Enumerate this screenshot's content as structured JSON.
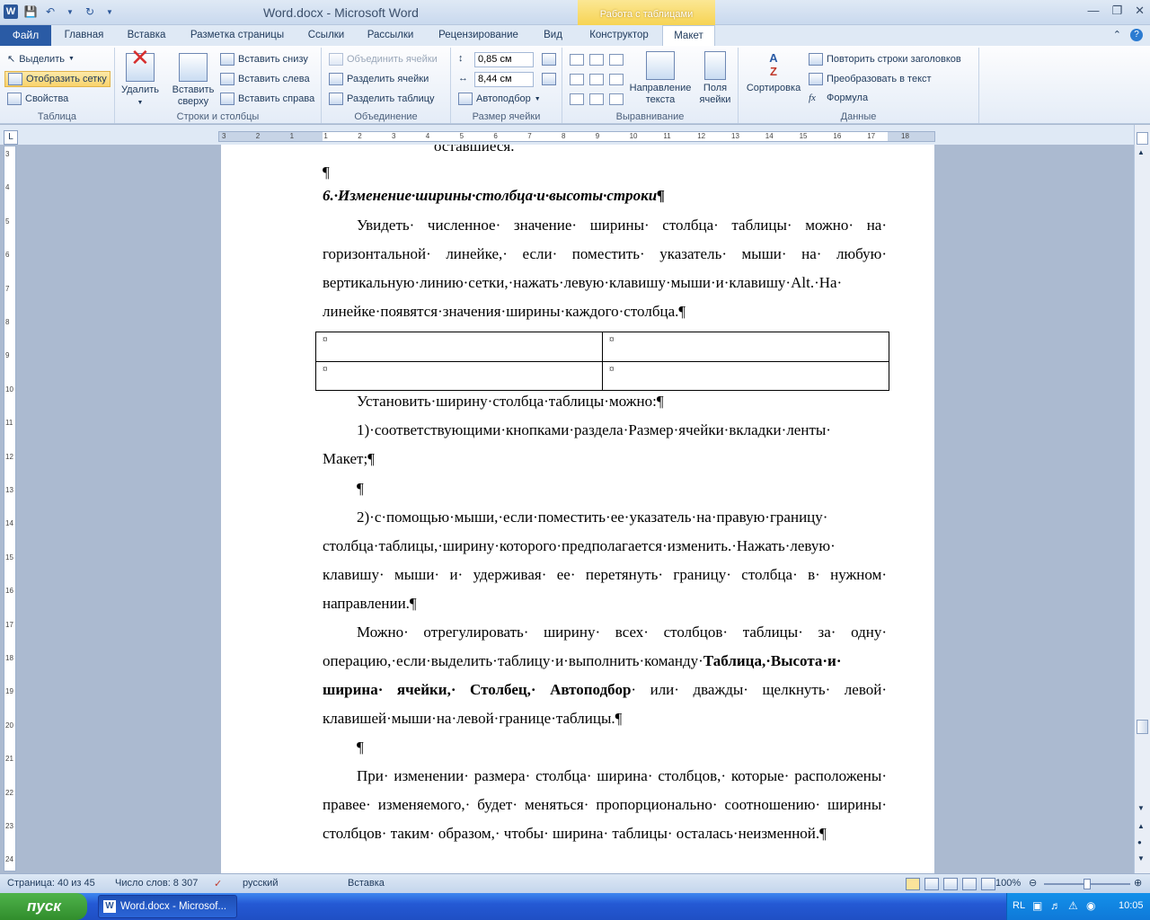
{
  "window": {
    "title": "Word.docx  -  Microsoft Word",
    "context_group": "Работа с таблицами"
  },
  "tabs": {
    "file": "Файл",
    "items": [
      "Главная",
      "Вставка",
      "Разметка страницы",
      "Ссылки",
      "Рассылки",
      "Рецензирование",
      "Вид",
      "Конструктор",
      "Макет"
    ],
    "active": "Макет"
  },
  "ribbon": {
    "table": {
      "title": "Таблица",
      "select": "Выделить",
      "show_grid": "Отобразить сетку",
      "properties": "Свойства"
    },
    "rows_cols": {
      "title": "Строки и столбцы",
      "delete": "Удалить",
      "insert_above_1": "Вставить",
      "insert_above_2": "сверху",
      "insert_below": "Вставить снизу",
      "insert_left": "Вставить слева",
      "insert_right": "Вставить справа"
    },
    "merge": {
      "title": "Объединение",
      "merge_cells": "Объединить ячейки",
      "split_cells": "Разделить ячейки",
      "split_table": "Разделить таблицу"
    },
    "cell_size": {
      "title": "Размер ячейки",
      "height": "0,85 см",
      "width": "8,44 см",
      "autofit": "Автоподбор"
    },
    "alignment": {
      "title": "Выравнивание",
      "direction_1": "Направление",
      "direction_2": "текста",
      "margins_1": "Поля",
      "margins_2": "ячейки"
    },
    "data": {
      "title": "Данные",
      "sort": "Сортировка",
      "repeat_header": "Повторить строки заголовков",
      "convert": "Преобразовать в текст",
      "formula": "Формула"
    }
  },
  "document": {
    "line0": "оставшиеся.",
    "empty_para": "¶",
    "heading": "6.·Изменение·ширины·столбца·и·высоты·строки¶",
    "para1": "Увидеть· численное· значение· ширины· столбца· таблицы· можно· на· горизонтальной· линейке,· если· поместить· указатель· мыши· на· любую· вертикальную·линию·сетки,·нажать·левую·клавишу·мыши·и·клавишу·Alt.·На· линейке·появятся·значения·ширины·каждого·столбца.¶",
    "cell_mark": "¤",
    "para2": "Установить·ширину·столбца·таблицы·можно:¶",
    "list1": "1)·соответствующими·кнопками·раздела·Размер·ячейки·вкладки·ленты· Макет;¶",
    "list2": "2)·с·помощью·мыши,·если·поместить·ее·указатель·на·правую·границу· столбца·таблицы,·ширину·которого·предполагается·изменить.·Нажать·левую· клавишу· мыши· и· удерживая· ее· перетянуть· границу· столбца· в· нужном· направлении.¶",
    "para3_a": "Можно· отрегулировать· ширину· всех· столбцов· таблицы· за· одну· операцию,·если·выделить·таблицу·и·выполнить·команду·",
    "para3_b": "Таблица,·Высота·и· ширина· ячейки,· Столбец,· Автоподбор",
    "para3_c": "· или· дважды· щелкнуть· левой· клавишей·мыши·на·левой·границе·таблицы.¶",
    "para4": "При· изменении· размера· столбца· ширина· столбцов,· которые· расположены· правее· изменяемого,· будет· меняться· пропорционально· соотношению· ширины· столбцов· таким· образом,· чтобы· ширина· таблицы· осталась·неизменной.¶"
  },
  "ruler": {
    "h_ticks": [
      "3",
      "2",
      "1",
      "1",
      "2",
      "3",
      "4",
      "5",
      "6",
      "7",
      "8",
      "9",
      "10",
      "11",
      "12",
      "13",
      "14",
      "15",
      "16",
      "17",
      "18"
    ],
    "v_ticks": [
      "3",
      "4",
      "5",
      "6",
      "7",
      "8",
      "9",
      "10",
      "11",
      "12",
      "13",
      "14",
      "15",
      "16",
      "17",
      "18",
      "19",
      "20",
      "21",
      "22",
      "23",
      "24"
    ]
  },
  "status": {
    "page": "Страница: 40 из 45",
    "words": "Число слов: 8 307",
    "lang": "русский",
    "mode": "Вставка",
    "zoom": "100%"
  },
  "taskbar": {
    "start": "пуск",
    "task": "Word.docx - Microsof...",
    "lang": "RL",
    "time": "10:05"
  }
}
